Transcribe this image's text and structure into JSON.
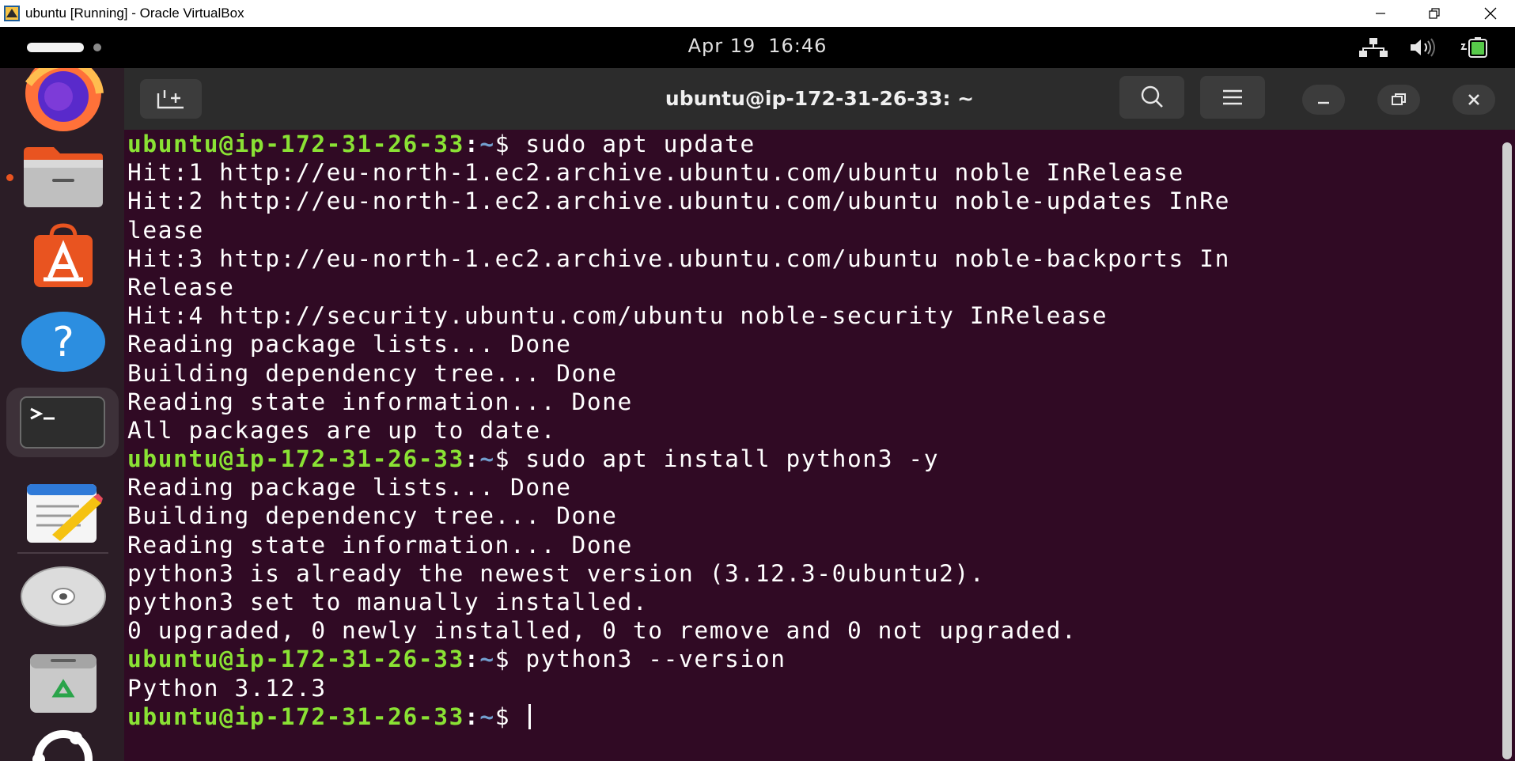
{
  "window": {
    "title": "ubuntu [Running] - Oracle VirtualBox",
    "controls": [
      "minimize-icon",
      "restore-icon",
      "close-icon"
    ]
  },
  "topbar": {
    "date": "Apr 19",
    "time": "16:46",
    "tray_icons": [
      "network-wired-icon",
      "volume-icon",
      "battery-charging-icon"
    ]
  },
  "dock": {
    "items": [
      {
        "icon": "firefox-icon",
        "running": false
      },
      {
        "icon": "files-folder-icon",
        "running": true
      },
      {
        "icon": "app-center-icon",
        "running": false
      },
      {
        "icon": "help-icon",
        "running": false
      },
      {
        "icon": "terminal-icon",
        "running": true,
        "active": true
      },
      {
        "icon": "text-editor-icon",
        "running": false
      },
      {
        "icon": "optical-disc-icon",
        "running": false
      },
      {
        "icon": "trash-icon",
        "running": false
      },
      {
        "icon": "ubuntu-logo-icon",
        "running": false
      }
    ]
  },
  "terminal": {
    "title": "ubuntu@ip-172-31-26-33: ~",
    "prompt": {
      "user_host": "ubuntu@ip-172-31-26-33",
      "colon": ":",
      "path": "~",
      "symbol": "$ "
    },
    "header_buttons": [
      "new-tab-icon",
      "search-icon",
      "hamburger-menu-icon",
      "minimize-icon",
      "restore-icon",
      "close-icon"
    ],
    "lines": [
      {
        "prompt": true,
        "text": "sudo apt update"
      },
      {
        "prompt": false,
        "text": "Hit:1 http://eu-north-1.ec2.archive.ubuntu.com/ubuntu noble InRelease"
      },
      {
        "prompt": false,
        "text": "Hit:2 http://eu-north-1.ec2.archive.ubuntu.com/ubuntu noble-updates InRe"
      },
      {
        "prompt": false,
        "text": "lease"
      },
      {
        "prompt": false,
        "text": "Hit:3 http://eu-north-1.ec2.archive.ubuntu.com/ubuntu noble-backports In"
      },
      {
        "prompt": false,
        "text": "Release"
      },
      {
        "prompt": false,
        "text": "Hit:4 http://security.ubuntu.com/ubuntu noble-security InRelease"
      },
      {
        "prompt": false,
        "text": "Reading package lists... Done"
      },
      {
        "prompt": false,
        "text": "Building dependency tree... Done"
      },
      {
        "prompt": false,
        "text": "Reading state information... Done"
      },
      {
        "prompt": false,
        "text": "All packages are up to date."
      },
      {
        "prompt": true,
        "text": "sudo apt install python3 -y"
      },
      {
        "prompt": false,
        "text": "Reading package lists... Done"
      },
      {
        "prompt": false,
        "text": "Building dependency tree... Done"
      },
      {
        "prompt": false,
        "text": "Reading state information... Done"
      },
      {
        "prompt": false,
        "text": "python3 is already the newest version (3.12.3-0ubuntu2)."
      },
      {
        "prompt": false,
        "text": "python3 set to manually installed."
      },
      {
        "prompt": false,
        "text": "0 upgraded, 0 newly installed, 0 to remove and 0 not upgraded."
      },
      {
        "prompt": true,
        "text": "python3 --version"
      },
      {
        "prompt": false,
        "text": "Python 3.12.3"
      },
      {
        "prompt": true,
        "text": "",
        "cursor": true
      }
    ]
  },
  "colors": {
    "terminal_bg": "#300a24",
    "prompt_user": "#8ae234",
    "prompt_path": "#729fcf",
    "header_bg": "#2c2c2c",
    "dock_bg": "#2b1d26",
    "running_indicator": "#e95420"
  }
}
